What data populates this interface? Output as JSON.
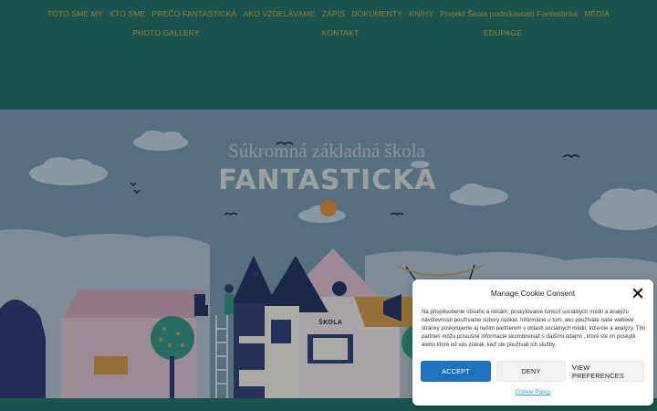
{
  "nav": {
    "row1": [
      "TOTO SME MY",
      "KTO SME",
      "PREČO FANTASTICKÁ",
      "AKO VZDELÁVAME",
      "ZÁPIS",
      "DOKUMENTY",
      "KNIHY",
      "Projekt Škola podnikavosti Fantastická",
      "MÉDIÁ"
    ],
    "row2": [
      "PHOTO GALLERY",
      "KONTAKT",
      "EDUPAGE"
    ]
  },
  "hero": {
    "title_line1": "Súkromná základná škola",
    "title_line2": "FANTASTICKÁ",
    "building_sign": "ŠKOLA"
  },
  "cookie": {
    "title": "Manage Cookie Consent",
    "text": "Na prispôsobenie obsahu a reklám, poskytovanie funkcií sociálnych médií a analýzu návštevnosti používame súbory cookie. Informácie o tom, ako používate naše webové stránky poskytujeme aj našim partnerom v oblasti sociálnych médií, inzercie a analýzy. Títo partneri môžu príslušné informácie skombinovať s ďalšími údajmi , ktoré ste im poskytli alebo ktoré od vás získali, keď ste používali ich služby.",
    "accept_label": "ACCEPT",
    "deny_label": "DENY",
    "preferences_label": "VIEW PREFERENCES",
    "policy_link": "Cookie Policy"
  },
  "colors": {
    "header_bg": "#1e6a5e",
    "nav_text": "#c9a43a",
    "sky": "#6f8fa0",
    "accept_button": "#1e73be",
    "policy_link": "#2f9fd8"
  }
}
